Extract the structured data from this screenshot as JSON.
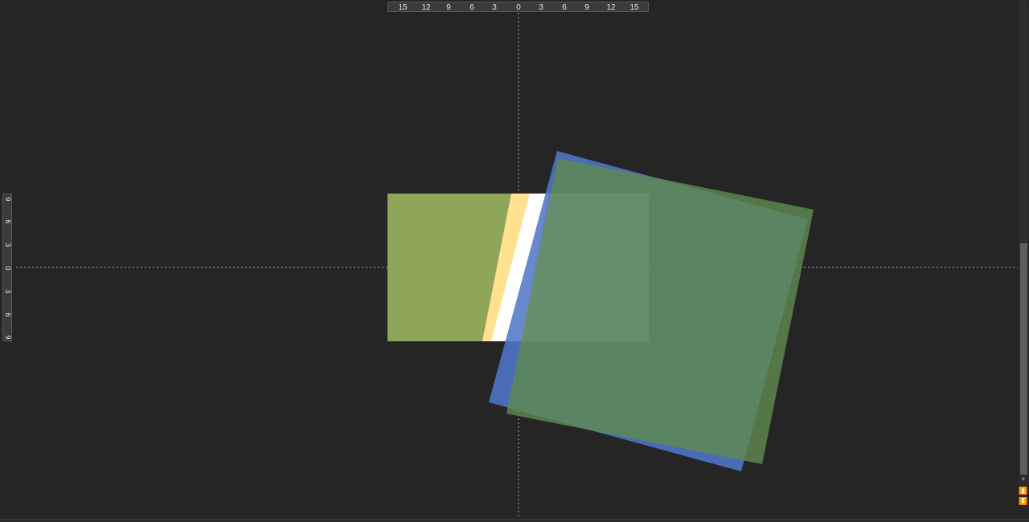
{
  "rulers": {
    "horizontal": [
      "15",
      "12",
      "9",
      "6",
      "3",
      "0",
      "3",
      "6",
      "9",
      "12",
      "15"
    ],
    "vertical": [
      "9",
      "6",
      "3",
      "0",
      "3",
      "6",
      "9"
    ]
  },
  "colors": {
    "background": "#252525",
    "slide_green": "#87a050",
    "yellow_stripe": "#ffe08a",
    "white_stripe": "#ffffff",
    "blue_square": "#4f74c7",
    "green_square": "#5f8a4f"
  },
  "scrollbar": {
    "down_glyph": "▾",
    "prev_page_glyph": "⏫",
    "next_page_glyph": "⏬"
  }
}
